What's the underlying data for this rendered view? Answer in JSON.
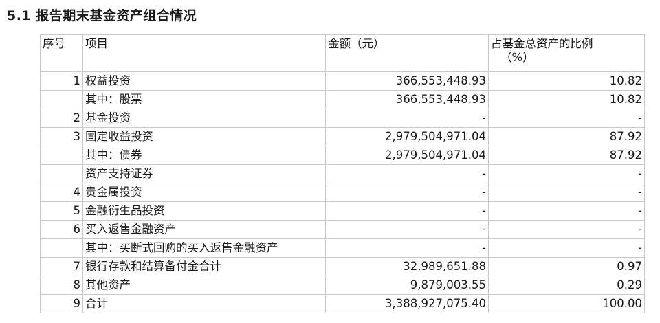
{
  "section_title": "5.1 报告期末基金资产组合情况",
  "table": {
    "headers": {
      "seq": "序号",
      "item": "项目",
      "amount": "金额（元）",
      "ratio_line1": "占基金总资产的比例",
      "ratio_line2": "（%）"
    },
    "rows": [
      {
        "seq": "1",
        "item": "权益投资",
        "amount": "366,553,448.93",
        "ratio": "10.82"
      },
      {
        "seq": "",
        "item": "其中：股票",
        "amount": "366,553,448.93",
        "ratio": "10.82"
      },
      {
        "seq": "2",
        "item": "基金投资",
        "amount": "-",
        "ratio": "-"
      },
      {
        "seq": "3",
        "item": "固定收益投资",
        "amount": "2,979,504,971.04",
        "ratio": "87.92"
      },
      {
        "seq": "",
        "item": "其中：债券",
        "amount": "2,979,504,971.04",
        "ratio": "87.92"
      },
      {
        "seq": "",
        "item": "资产支持证券",
        "amount": "-",
        "ratio": "-"
      },
      {
        "seq": "4",
        "item": "贵金属投资",
        "amount": "-",
        "ratio": "-"
      },
      {
        "seq": "5",
        "item": "金融衍生品投资",
        "amount": "-",
        "ratio": "-"
      },
      {
        "seq": "6",
        "item": "买入返售金融资产",
        "amount": "-",
        "ratio": "-"
      },
      {
        "seq": "",
        "item": "其中：买断式回购的买入返售金融资产",
        "amount": "-",
        "ratio": "-"
      },
      {
        "seq": "7",
        "item": "银行存款和结算备付金合计",
        "amount": "32,989,651.88",
        "ratio": "0.97"
      },
      {
        "seq": "8",
        "item": "其他资产",
        "amount": "9,879,003.55",
        "ratio": "0.29"
      },
      {
        "seq": "9",
        "item": "合计",
        "amount": "3,388,927,075.40",
        "ratio": "100.00"
      }
    ]
  }
}
